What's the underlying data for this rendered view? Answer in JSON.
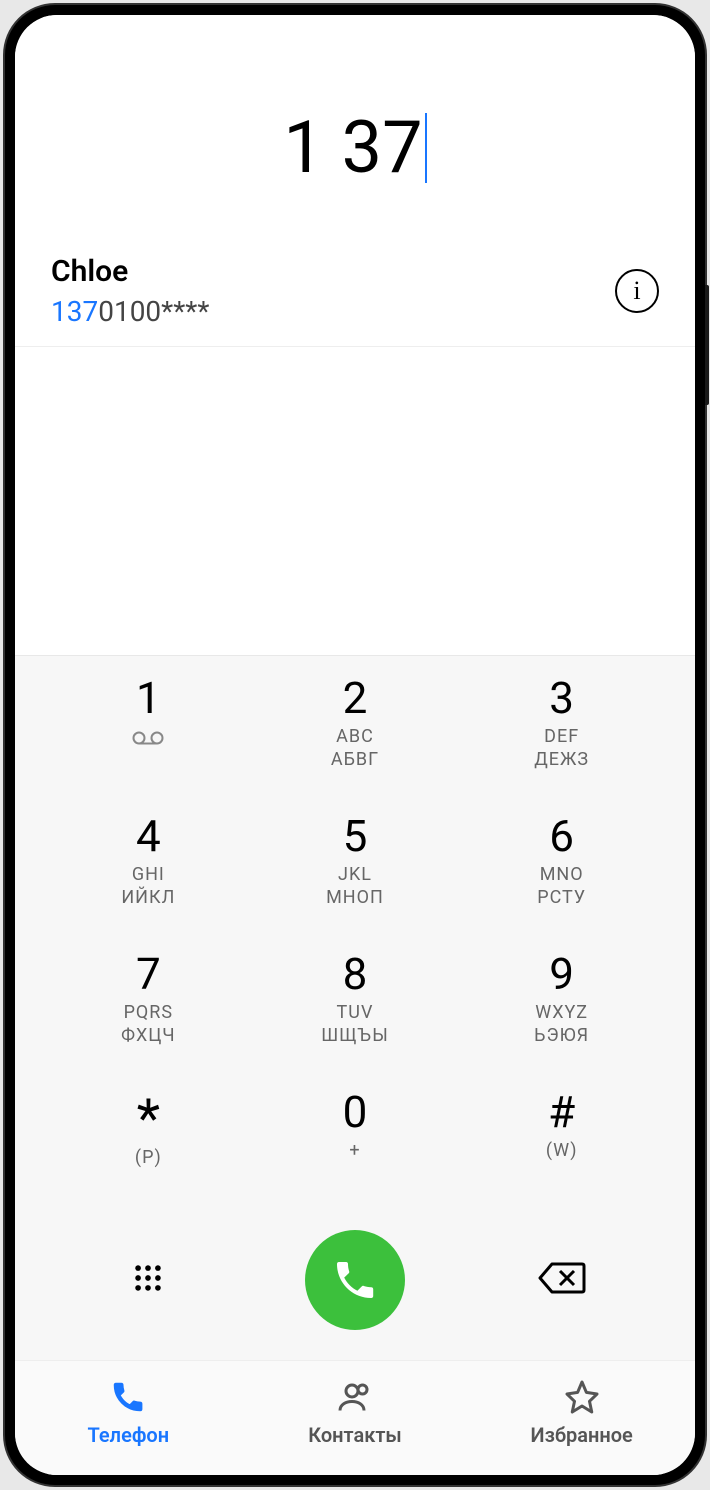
{
  "dialed": "1 37",
  "contact": {
    "name": "Chloe",
    "number_match": "137",
    "number_rest": "0100****"
  },
  "keypad": [
    {
      "digit": "1",
      "sub1": "",
      "sub2": "",
      "vm": true
    },
    {
      "digit": "2",
      "sub1": "ABC",
      "sub2": "АБВГ"
    },
    {
      "digit": "3",
      "sub1": "DEF",
      "sub2": "ДЕЖЗ"
    },
    {
      "digit": "4",
      "sub1": "GHI",
      "sub2": "ИЙКЛ"
    },
    {
      "digit": "5",
      "sub1": "JKL",
      "sub2": "МНОП"
    },
    {
      "digit": "6",
      "sub1": "MNO",
      "sub2": "РСТУ"
    },
    {
      "digit": "7",
      "sub1": "PQRS",
      "sub2": "ФХЦЧ"
    },
    {
      "digit": "8",
      "sub1": "TUV",
      "sub2": "ШЩЪЫ"
    },
    {
      "digit": "9",
      "sub1": "WXYZ",
      "sub2": "ЬЭЮЯ"
    },
    {
      "digit": "*",
      "sub1": "(P)",
      "sub2": ""
    },
    {
      "digit": "0",
      "sub1": "+",
      "sub2": ""
    },
    {
      "digit": "#",
      "sub1": "(W)",
      "sub2": ""
    }
  ],
  "nav": {
    "phone": "Телефон",
    "contacts": "Контакты",
    "favorites": "Избранное"
  },
  "colors": {
    "accent": "#1976ff",
    "call": "#3cc03c"
  }
}
